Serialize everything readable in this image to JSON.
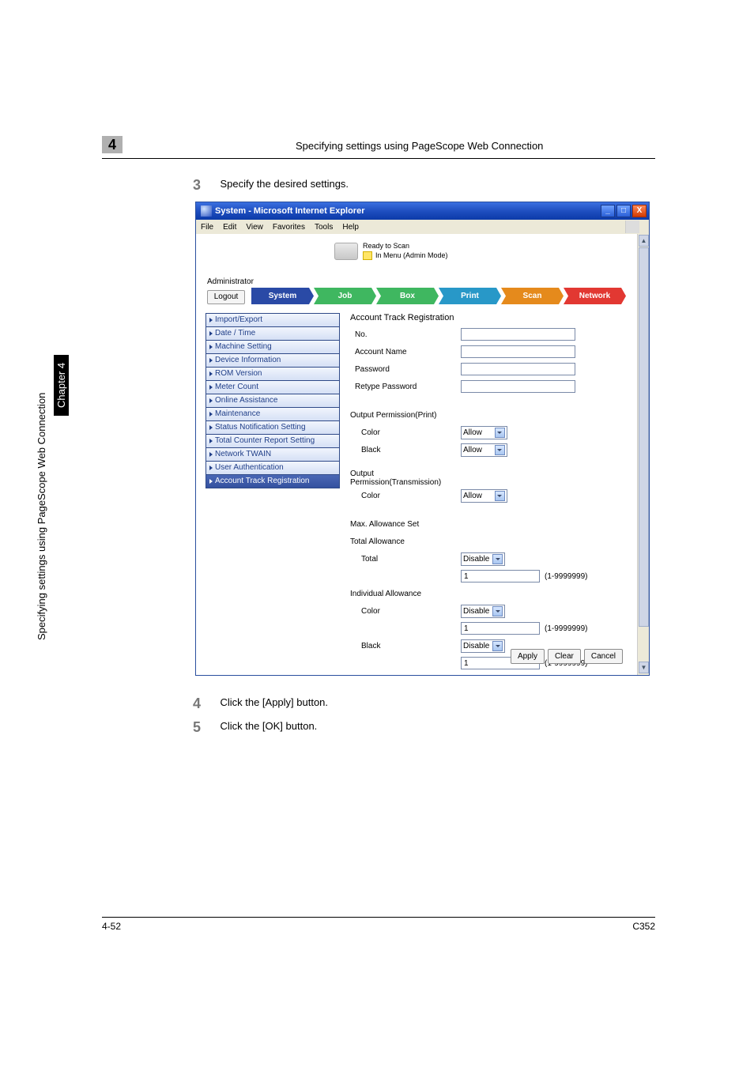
{
  "header": {
    "chapter_num": "4",
    "section_title": "Specifying settings using PageScope Web Connection"
  },
  "steps": {
    "s3_num": "3",
    "s3_text": "Specify the desired settings.",
    "s4_num": "4",
    "s4_text": "Click the [Apply] button.",
    "s5_num": "5",
    "s5_text": "Click the [OK] button."
  },
  "window": {
    "title": "System - Microsoft Internet Explorer",
    "min": "_",
    "max": "□",
    "close": "X",
    "menus": {
      "file": "File",
      "edit": "Edit",
      "view": "View",
      "fav": "Favorites",
      "tools": "Tools",
      "help": "Help"
    },
    "status1": "Ready to Scan",
    "status2": "In Menu (Admin Mode)",
    "admin": "Administrator",
    "logout": "Logout",
    "tabs": {
      "system": "System",
      "job": "Job",
      "box": "Box",
      "print": "Print",
      "scan": "Scan",
      "network": "Network"
    },
    "sidebar": {
      "import_export": "Import/Export",
      "date_time": "Date / Time",
      "machine": "Machine Setting",
      "device": "Device Information",
      "rom": "ROM Version",
      "meter": "Meter Count",
      "online": "Online Assistance",
      "maint": "Maintenance",
      "status_notif": "Status Notification Setting",
      "total_counter": "Total Counter Report Setting",
      "twain": "Network TWAIN",
      "user_auth": "User Authentication",
      "acct_track": "Account Track Registration"
    },
    "form": {
      "title": "Account Track Registration",
      "no_label": "No.",
      "acct_name_label": "Account Name",
      "password_label": "Password",
      "retype_label": "Retype Password",
      "op_print_title": "Output Permission(Print)",
      "color_label": "Color",
      "black_label": "Black",
      "allow": "Allow",
      "op_trans_title": "Output Permission(Transmission)",
      "max_allow_title": "Max. Allowance Set",
      "total_allow_label": "Total Allowance",
      "total_label": "Total",
      "indiv_allow_label": "Individual Allowance",
      "disable": "Disable",
      "one": "1",
      "range": "(1-9999999)",
      "apply": "Apply",
      "clear": "Clear",
      "cancel": "Cancel"
    }
  },
  "side_text": "Specifying settings using PageScope Web Connection",
  "side_badge": "Chapter 4",
  "footer": {
    "left": "4-52",
    "right": "C352"
  }
}
